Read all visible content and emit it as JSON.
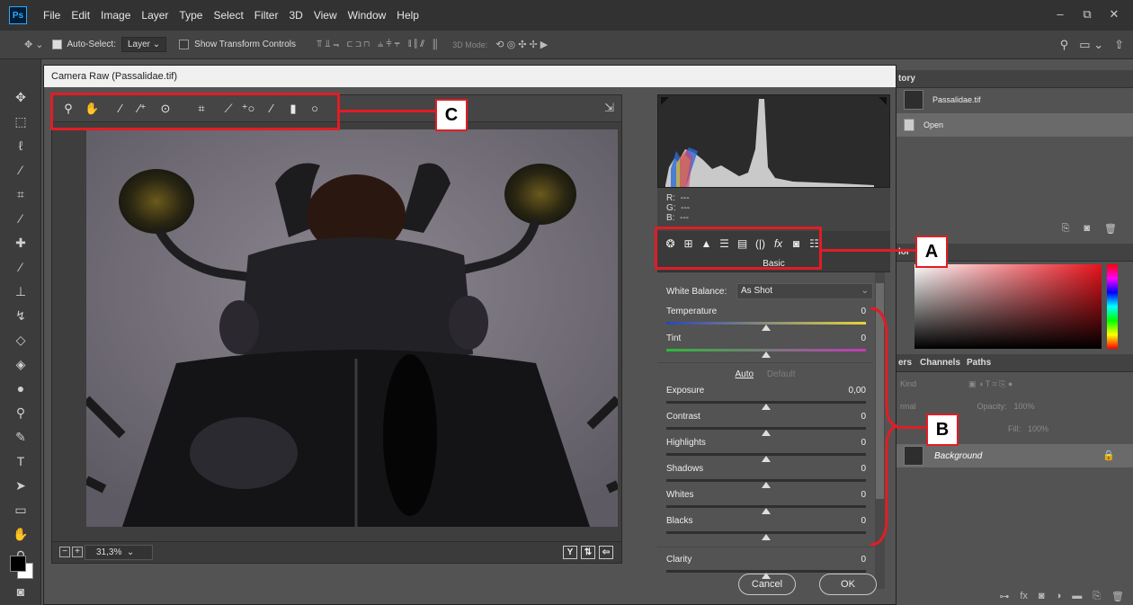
{
  "app": {
    "logo": "Ps",
    "menu": [
      "File",
      "Edit",
      "Image",
      "Layer",
      "Type",
      "Select",
      "Filter",
      "3D",
      "View",
      "Window",
      "Help"
    ]
  },
  "options_bar": {
    "auto_select_label": "Auto-Select:",
    "auto_select_checked": true,
    "target": "Layer",
    "transform_label": "Show Transform Controls",
    "mode_label": "3D Mode:"
  },
  "dialog": {
    "title": "Camera Raw (Passalidae.tif)",
    "zoom": "31,3%",
    "rgb": {
      "r_label": "R:",
      "r_value": "---",
      "g_label": "G:",
      "g_value": "---",
      "b_label": "B:",
      "b_value": "---"
    },
    "panel_title": "Basic",
    "white_balance_label": "White Balance:",
    "white_balance_value": "As Shot",
    "auto_label": "Auto",
    "default_label": "Default",
    "sliders": [
      {
        "label": "Temperature",
        "value": "0",
        "fraction": 0.5
      },
      {
        "label": "Tint",
        "value": "0",
        "fraction": 0.5
      },
      {
        "label": "Exposure",
        "value": "0,00",
        "fraction": 0.5
      },
      {
        "label": "Contrast",
        "value": "0",
        "fraction": 0.5
      },
      {
        "label": "Highlights",
        "value": "0",
        "fraction": 0.5
      },
      {
        "label": "Shadows",
        "value": "0",
        "fraction": 0.5
      },
      {
        "label": "Whites",
        "value": "0",
        "fraction": 0.5
      },
      {
        "label": "Blacks",
        "value": "0",
        "fraction": 0.5
      },
      {
        "label": "Clarity",
        "value": "0",
        "fraction": 0.5
      }
    ],
    "cancel_label": "Cancel",
    "ok_label": "OK",
    "view_buttons": [
      "Y",
      "⇅",
      "⇦"
    ]
  },
  "panels": {
    "history_tab": "tory",
    "history_items": [
      "Passalidae.tif",
      "Open"
    ],
    "color_tab": "lor",
    "layers_tabs": [
      "ers",
      "Channels",
      "Paths"
    ],
    "kind_label": "Kind",
    "blend_mode": "rmal",
    "opacity_label": "Opacity:",
    "opacity_value": "100%",
    "fill_label": "Fill:",
    "fill_value": "100%",
    "layer_name": "Background"
  },
  "annotations": {
    "a": "A",
    "b": "B",
    "c": "C"
  },
  "colors": {
    "annotation_red": "#e01d25",
    "picker_hue": "#e8131c"
  }
}
